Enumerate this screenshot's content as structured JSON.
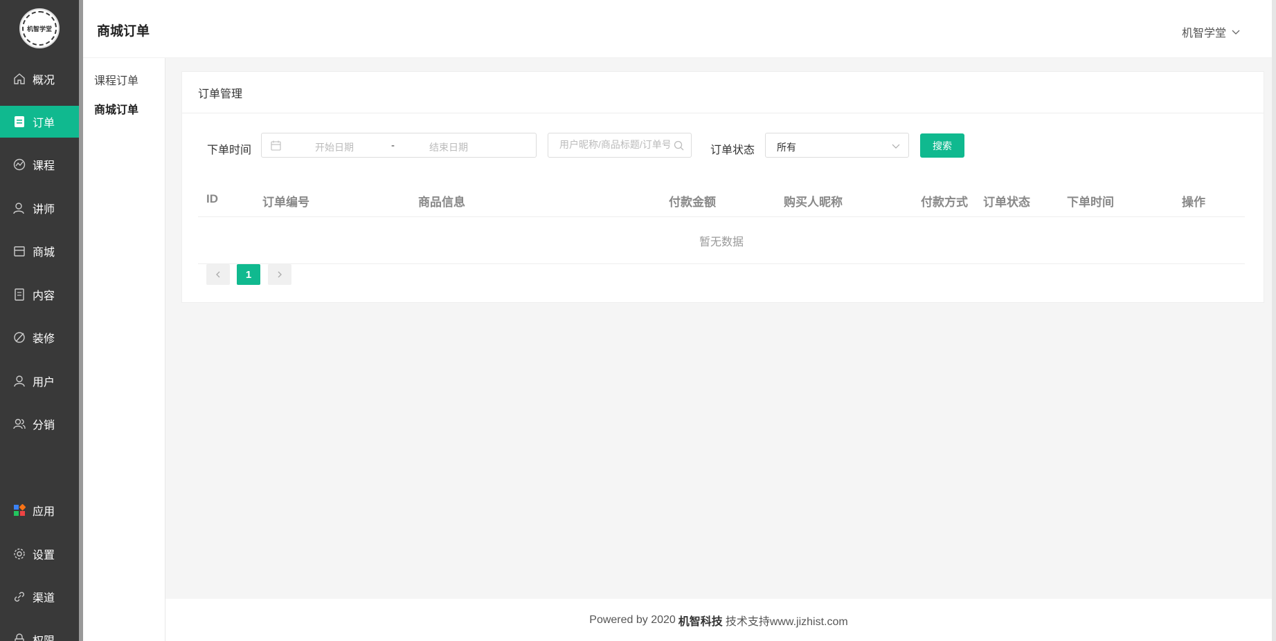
{
  "app": {
    "logo_text": "机智学堂",
    "header_title": "商城订单",
    "user_name": "机智学堂"
  },
  "sidebar": {
    "items": [
      {
        "label": "概况",
        "icon": "home-icon",
        "active": false
      },
      {
        "label": "订单",
        "icon": "order-icon",
        "active": true
      },
      {
        "label": "课程",
        "icon": "course-icon",
        "active": false
      },
      {
        "label": "讲师",
        "icon": "teacher-icon",
        "active": false
      },
      {
        "label": "商城",
        "icon": "store-icon",
        "active": false
      },
      {
        "label": "内容",
        "icon": "content-icon",
        "active": false
      },
      {
        "label": "装修",
        "icon": "decorate-icon",
        "active": false
      },
      {
        "label": "用户",
        "icon": "user-icon",
        "active": false
      },
      {
        "label": "分销",
        "icon": "distribution-icon",
        "active": false
      },
      {
        "label": "应用",
        "icon": "apps-icon",
        "active": false
      },
      {
        "label": "设置",
        "icon": "gear-icon",
        "active": false
      },
      {
        "label": "渠道",
        "icon": "link-icon",
        "active": false
      },
      {
        "label": "权限",
        "icon": "lock-icon",
        "active": false
      }
    ]
  },
  "subnav": {
    "items": [
      {
        "label": "课程订单",
        "active": false
      },
      {
        "label": "商城订单",
        "active": true
      }
    ]
  },
  "card": {
    "title": "订单管理"
  },
  "filters": {
    "order_time_label": "下单时间",
    "start_placeholder": "开始日期",
    "range_separator": "-",
    "end_placeholder": "结束日期",
    "search_placeholder": "用户昵称/商品标题/订单号",
    "status_label": "订单状态",
    "status_value": "所有",
    "search_button": "搜索"
  },
  "table": {
    "columns": [
      "ID",
      "订单编号",
      "商品信息",
      "付款金额",
      "购买人昵称",
      "付款方式",
      "订单状态",
      "下单时间",
      "操作"
    ],
    "empty_text": "暂无数据"
  },
  "pagination": {
    "current_page": "1"
  },
  "footer": {
    "prefix": "Powered by 2020",
    "company": "机智科技",
    "suffix": "技术支持www.jizhist.com"
  },
  "colors": {
    "accent": "#10b98f",
    "sidebar_bg": "#393939"
  }
}
